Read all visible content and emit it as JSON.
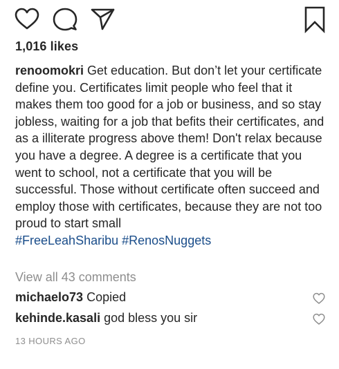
{
  "post": {
    "likes": "1,016 likes",
    "caption": {
      "username": "renoomokri",
      "text": "Get education. But don’t let your certificate define you. Certificates limit people who feel that it makes them too good for a job or business, and so stay jobless, waiting for a job that befits their certificates, and as a illiterate progress above them! Don't relax because you have a degree. A degree is a certificate that you went to school, not a certificate that you will be successful. Those without certificate often succeed and employ those with certificates, because they are not too proud to start small",
      "hashtags": [
        "#FreeLeahSharibu",
        "#RenosNuggets"
      ]
    },
    "view_all_comments": "View all 43 comments",
    "comments": [
      {
        "username": "michaelo73",
        "text": "Copied"
      },
      {
        "username": "kehinde.kasali",
        "text": "god bless you sir"
      }
    ],
    "timestamp": "13 HOURS AGO"
  },
  "icons": {
    "like": "heart-outline-icon",
    "comment": "speech-bubble-icon",
    "share": "paper-plane-icon",
    "save": "bookmark-icon",
    "comment_like": "small-heart-icon"
  },
  "colors": {
    "text": "#262626",
    "secondary": "#8e8e8e",
    "hashtag": "#1a4d8a"
  }
}
